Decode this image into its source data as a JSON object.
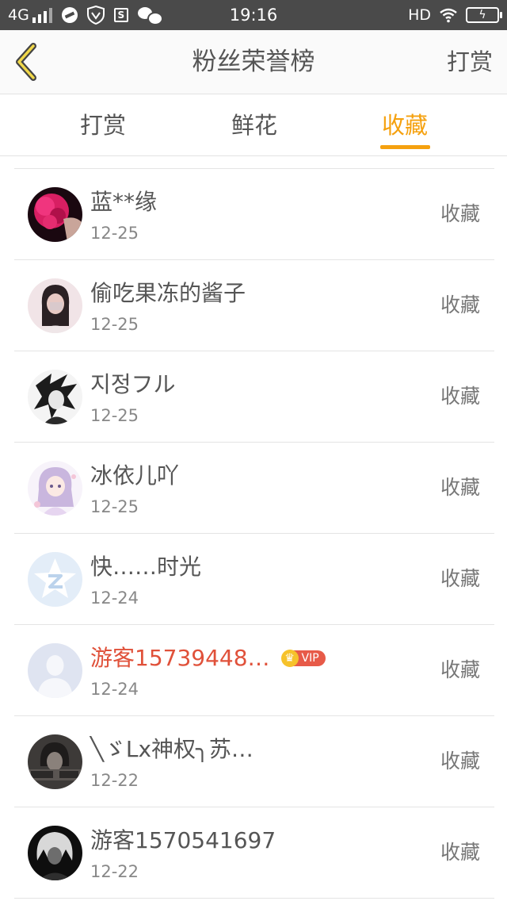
{
  "status_bar": {
    "network": "4G",
    "time": "19:16",
    "hd": "HD",
    "battery_icon": "battery-charging-icon"
  },
  "header": {
    "title": "粉丝荣誉榜",
    "right_action": "打赏",
    "back_icon": "chevron-left-icon"
  },
  "tabs": [
    {
      "label": "打赏",
      "active": false
    },
    {
      "label": "鲜花",
      "active": false
    },
    {
      "label": "收藏",
      "active": true
    }
  ],
  "accent_color": "#f5a10f",
  "list": [
    {
      "name": "蓝**缘",
      "date": "12-25",
      "action": "收藏",
      "avatar": "flower-photo"
    },
    {
      "name": "偷吃果冻的酱子",
      "date": "12-25",
      "action": "收藏",
      "avatar": "girl-photo"
    },
    {
      "name": "지정フル",
      "date": "12-25",
      "action": "收藏",
      "avatar": "anime-dark-photo"
    },
    {
      "name": "冰依儿吖",
      "date": "12-25",
      "action": "收藏",
      "avatar": "anime-girl-photo"
    },
    {
      "name": "快……时光",
      "date": "12-24",
      "action": "收藏",
      "avatar": "qq-logo-avatar"
    },
    {
      "name": "游客15739448…",
      "date": "12-24",
      "action": "收藏",
      "avatar": "default-user-avatar",
      "vip": "VIP"
    },
    {
      "name": "╲ゞLx神权╮苏…",
      "date": "12-22",
      "action": "收藏",
      "avatar": "dark-portrait-photo"
    },
    {
      "name": "游客1570541697",
      "date": "12-22",
      "action": "收藏",
      "avatar": "white-hair-anime-photo"
    }
  ]
}
